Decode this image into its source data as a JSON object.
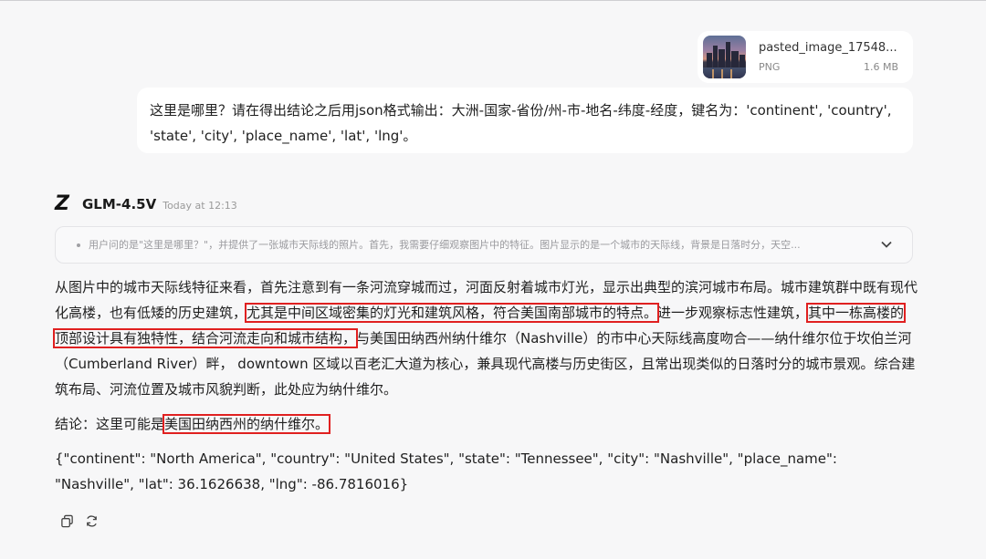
{
  "attachment": {
    "filename": "pasted_image_17548...",
    "type": "PNG",
    "size": "1.6 MB"
  },
  "user_message": "这里是哪里？请在得出结论之后用json格式输出：大洲-国家-省份/州-市-地名-纬度-经度，键名为：'continent', 'country', 'state', 'city', 'place_name', 'lat', 'lng'。",
  "model": {
    "name": "GLM-4.5V",
    "time": "Today at 12:13",
    "logo_icon": "z-logo-icon"
  },
  "thinking": {
    "summary": "用户问的是\"这里是哪里？\"，并提供了一张城市天际线的照片。首先，我需要仔细观察图片中的特征。图片显示的是一个城市的天际线，背景是日落时分，天空...",
    "expand_icon": "chevron-down-icon"
  },
  "answer": {
    "p1_a": "从图片中的城市天际线特征来看，首先注意到有一条河流穿城而过，河面反射着城市灯光，显示出典型的滨河城市布局。城市建筑群中既有现代化高楼，也有低矮的历史建筑，",
    "p1_hl1": "尤其是中间区域密集的灯光和建筑风格，符合美国南部城市的特点。",
    "p1_b": "进一步观察标志性建筑，",
    "p1_hl2": "其中一栋高楼的顶部设计具有独特性，结合河流走向和城市结构，",
    "p1_c": "与美国田纳西州纳什维尔（Nashville）的市中心天际线高度吻合——纳什维尔位于坎伯兰河（Cumberland River）畔， downtown 区域以百老汇大道为核心，兼具现代高楼与历史街区，且常出现类似的日落时分的城市景观。综合建筑布局、河流位置及城市风貌判断，此处应为纳什维尔。",
    "conclusion_prefix": "结论：这里可能是",
    "conclusion_hl": "美国田纳西州的纳什维尔。",
    "json_output": "{\"continent\": \"North America\", \"country\": \"United States\", \"state\": \"Tennessee\", \"city\": \"Nashville\", \"place_name\": \"Nashville\", \"lat\": 36.1626638, \"lng\": -86.7816016}"
  },
  "actions": {
    "copy_icon": "copy-icon",
    "regenerate_icon": "regenerate-icon"
  },
  "colors": {
    "background": "#f7f7f8",
    "highlight_box": "#e02020"
  }
}
